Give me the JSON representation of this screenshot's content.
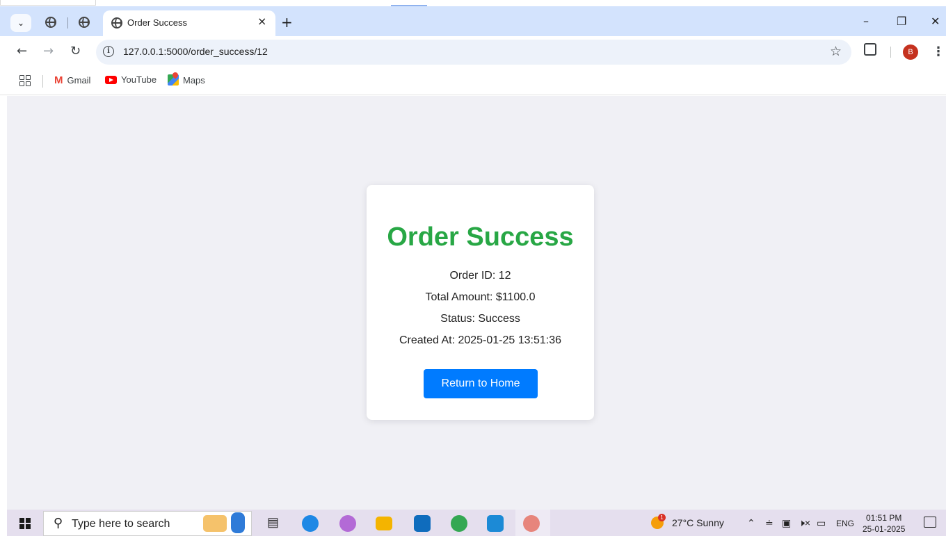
{
  "browser": {
    "tab_title": "Order Success",
    "tab_close": "×",
    "new_tab": "+",
    "url": "127.0.0.1:5000/order_success/12",
    "avatar_letter": "B",
    "window_controls": {
      "minimize": "–",
      "maximize": "❐",
      "close": "✕"
    },
    "bookmarks": [
      {
        "label": "Gmail",
        "icon": "gmail-icon"
      },
      {
        "label": "YouTube",
        "icon": "youtube-icon"
      },
      {
        "label": "Maps",
        "icon": "maps-icon"
      }
    ]
  },
  "page": {
    "heading": "Order Success",
    "order_id_line": "Order ID: 12",
    "total_line": "Total Amount: $1100.0",
    "status_line": "Status: Success",
    "created_line": "Created At: 2025-01-25 13:51:36",
    "button_label": "Return to Home",
    "colors": {
      "heading": "#28a745",
      "button": "#007bff",
      "background": "#f0f0f5"
    }
  },
  "taskbar": {
    "search_placeholder": "Type here to search",
    "weather_badge": "1",
    "weather": "27°C  Sunny",
    "language": "ENG",
    "time": "01:51 PM",
    "date": "25-01-2025"
  }
}
